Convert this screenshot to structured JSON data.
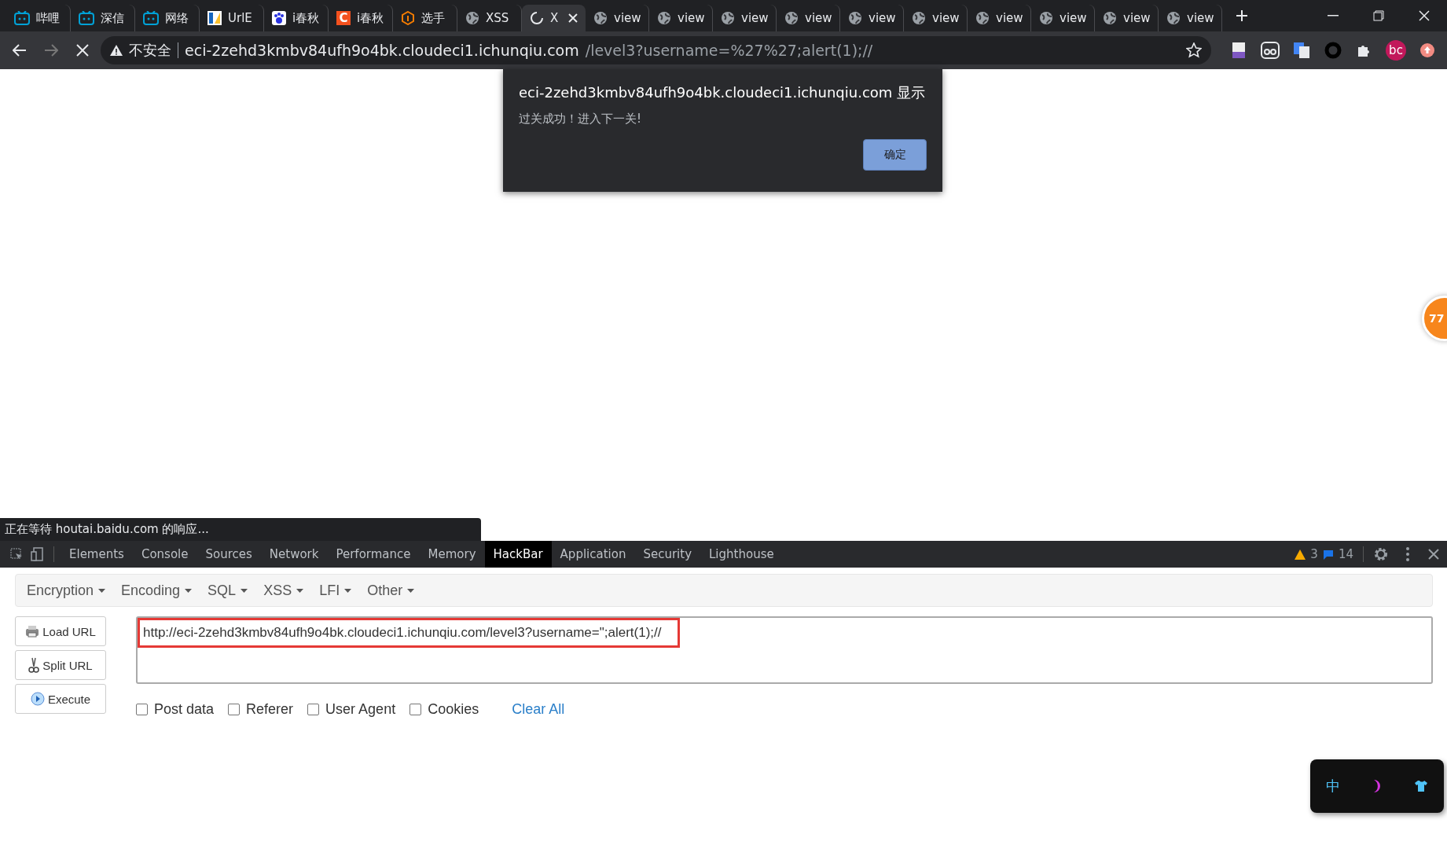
{
  "tabs": [
    {
      "title": "哔哩",
      "kind": "tv",
      "selected": false
    },
    {
      "title": "深信",
      "kind": "tv",
      "selected": false
    },
    {
      "title": "网络",
      "kind": "tv",
      "selected": false
    },
    {
      "title": "UrlE",
      "kind": "bars",
      "selected": false
    },
    {
      "title": "i春秋",
      "kind": "paw",
      "selected": false
    },
    {
      "title": "i春秋",
      "kind": "letter",
      "selected": false
    },
    {
      "title": "选手",
      "kind": "hex",
      "selected": false
    },
    {
      "title": "XSS",
      "kind": "globe",
      "selected": false
    },
    {
      "title": "X",
      "kind": "spinner",
      "selected": true
    },
    {
      "title": "view",
      "kind": "globe",
      "selected": false
    },
    {
      "title": "view",
      "kind": "globe",
      "selected": false
    },
    {
      "title": "view",
      "kind": "globe",
      "selected": false
    },
    {
      "title": "view",
      "kind": "globe",
      "selected": false
    },
    {
      "title": "view",
      "kind": "globe",
      "selected": false
    },
    {
      "title": "view",
      "kind": "globe",
      "selected": false
    },
    {
      "title": "view",
      "kind": "globe",
      "selected": false
    },
    {
      "title": "view",
      "kind": "globe",
      "selected": false
    },
    {
      "title": "view",
      "kind": "globe",
      "selected": false
    },
    {
      "title": "view",
      "kind": "globe",
      "selected": false
    }
  ],
  "address": {
    "security": "不安全",
    "host": "eci-2zehd3kmbv84ufh9o4bk.cloudeci1.ichunqiu.com",
    "path": "/level3?username=%27%27;alert(1);//"
  },
  "profile": "bc",
  "letter_icon": "C",
  "dialog": {
    "title": "eci-2zehd3kmbv84ufh9o4bk.cloudeci1.ichunqiu.com 显示",
    "message": "过关成功！进入下一关!",
    "button": "确定"
  },
  "float_badge": "77",
  "status": "正在等待 houtai.baidu.com 的响应...",
  "devtools": {
    "tabs": [
      {
        "label": "Elements",
        "selected": false
      },
      {
        "label": "Console",
        "selected": false
      },
      {
        "label": "Sources",
        "selected": false
      },
      {
        "label": "Network",
        "selected": false
      },
      {
        "label": "Performance",
        "selected": false
      },
      {
        "label": "Memory",
        "selected": false
      },
      {
        "label": "HackBar",
        "selected": true
      },
      {
        "label": "Application",
        "selected": false
      },
      {
        "label": "Security",
        "selected": false
      },
      {
        "label": "Lighthouse",
        "selected": false
      }
    ],
    "warnings": "3",
    "messages": "14"
  },
  "hackbar": {
    "menus": [
      "Encryption",
      "Encoding",
      "SQL",
      "XSS",
      "LFI",
      "Other"
    ],
    "buttons": [
      {
        "label": "Load URL",
        "kind": "load"
      },
      {
        "label": "Split URL",
        "kind": "split"
      },
      {
        "label": "Execute",
        "kind": "execute"
      }
    ],
    "url": "http://eci-2zehd3kmbv84ufh9o4bk.cloudeci1.ichunqiu.com/level3?username=\";alert(1);//",
    "options": [
      {
        "label": "Post data",
        "checked": false
      },
      {
        "label": "Referer",
        "checked": false
      },
      {
        "label": "User Agent",
        "checked": false
      },
      {
        "label": "Cookies",
        "checked": false
      }
    ],
    "clear": "Clear All"
  },
  "widget": {
    "label": "中"
  }
}
